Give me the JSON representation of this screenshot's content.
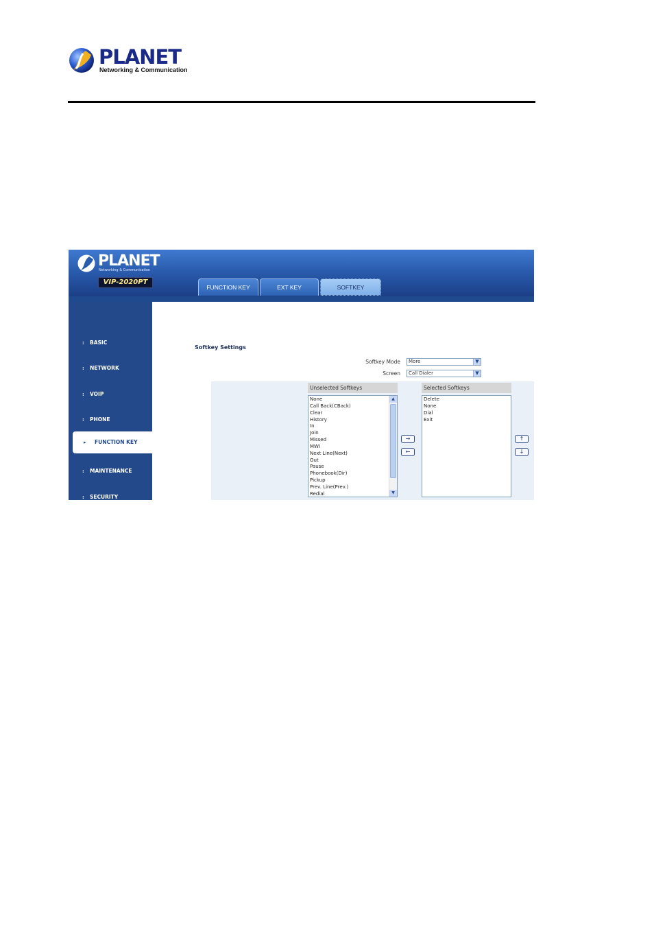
{
  "document": {
    "logo": {
      "brand": "PLANET",
      "tagline": "Networking & Communication"
    }
  },
  "ui": {
    "logo": {
      "brand": "PLANET",
      "tagline": "Networking & Communication"
    },
    "model": "VIP-2020PT",
    "tabs": [
      {
        "label": "FUNCTION KEY",
        "active": false
      },
      {
        "label": "EXT KEY",
        "active": false
      },
      {
        "label": "SOFTKEY",
        "active": true
      }
    ],
    "sidebar": {
      "items": [
        {
          "label": "BASIC",
          "active": false
        },
        {
          "label": "NETWORK",
          "active": false
        },
        {
          "label": "VOIP",
          "active": false
        },
        {
          "label": "PHONE",
          "active": false
        },
        {
          "label": "FUNCTION KEY",
          "active": true
        },
        {
          "label": "MAINTENANCE",
          "active": false
        },
        {
          "label": "SECURITY",
          "active": false
        }
      ]
    },
    "softkey_settings": {
      "title": "Softkey Settings",
      "softkey_mode": {
        "label": "Softkey Mode",
        "value": "More"
      },
      "screen": {
        "label": "Screen",
        "value": "Call Dialer"
      },
      "unselected": {
        "header": "Unselected Softkeys",
        "items": [
          "None",
          "Call Back(CBack)",
          "Clear",
          "History",
          "In",
          "Join",
          "Missed",
          "MWI",
          "Next Line(Next)",
          "Out",
          "Pause",
          "Phonebook(Dir)",
          "Pickup",
          "Prev. Line(Prev.)",
          "Redial"
        ]
      },
      "selected": {
        "header": "Selected Softkeys",
        "items": [
          "Delete",
          "None",
          "Dial",
          "Exit"
        ]
      },
      "buttons": {
        "add": "→",
        "remove": "←",
        "move_up": "↑",
        "move_down": "↓"
      }
    }
  }
}
